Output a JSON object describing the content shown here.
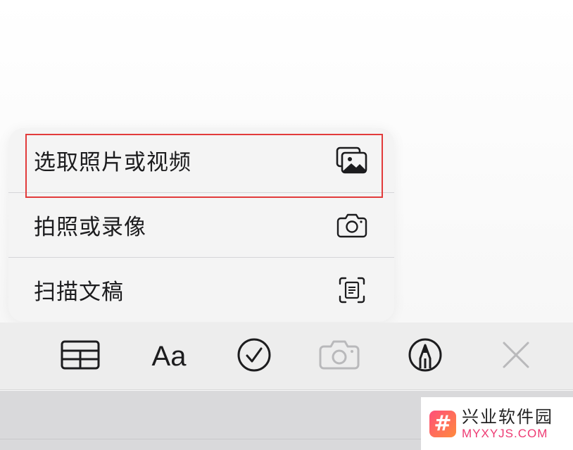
{
  "menu": {
    "items": [
      {
        "label": "选取照片或视频",
        "icon": "photo-library-icon"
      },
      {
        "label": "拍照或录像",
        "icon": "camera-icon"
      },
      {
        "label": "扫描文稿",
        "icon": "document-scan-icon"
      }
    ]
  },
  "toolbar": {
    "buttons": [
      {
        "icon": "table-icon"
      },
      {
        "label": "Aa",
        "icon": "text-format-icon"
      },
      {
        "icon": "checklist-icon"
      },
      {
        "icon": "camera-icon",
        "state": "active-dimmed"
      },
      {
        "icon": "markup-pen-icon"
      },
      {
        "icon": "close-icon"
      }
    ]
  },
  "watermark": {
    "logo_glyph": "#",
    "title": "兴业软件园",
    "subtitle": "MYXYJS.COM"
  },
  "colors": {
    "highlight": "#e23b3b",
    "menu_bg": "#f4f4f4",
    "toolbar_bg": "#ededed",
    "dimmed_icon": "#b9b9bb",
    "watermark_accent": "#ee3a73"
  }
}
